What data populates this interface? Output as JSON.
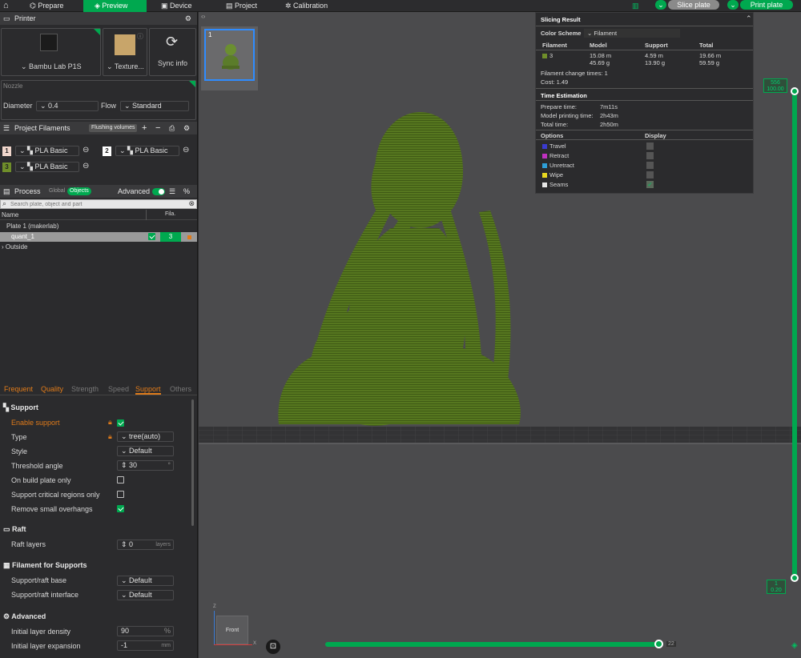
{
  "topbar": {
    "tabs": [
      "Prepare",
      "Preview",
      "Device",
      "Project",
      "Calibration"
    ],
    "slice_label": "Slice plate",
    "print_label": "Print plate"
  },
  "printer": {
    "section_title": "Printer",
    "model": "Bambu Lab P1S",
    "plate": "Texture...",
    "sync_label": "Sync info",
    "nozzle_label": "Nozzle",
    "diameter_label": "Diameter",
    "diameter_value": "0.4",
    "flow_label": "Flow",
    "flow_value": "Standard"
  },
  "filaments": {
    "section_title": "Project Filaments",
    "flushing_label": "Flushing volumes",
    "items": [
      {
        "num": "1",
        "name": "PLA Basic",
        "color": "#f0d6cc"
      },
      {
        "num": "2",
        "name": "PLA Basic",
        "color": "#ffffff"
      },
      {
        "num": "3",
        "name": "PLA Basic",
        "color": "#6f8e2a"
      }
    ]
  },
  "process": {
    "section_title": "Process",
    "global_label": "Global",
    "objects_label": "Objects",
    "advanced_label": "Advanced",
    "search_placeholder": "Search plate, object and part",
    "col_name": "Name",
    "col_fila": "Fila.",
    "plate_row": "Plate 1 (makerlab)",
    "object_name": "quant_1",
    "object_fila": "3",
    "outside_row": "Outside"
  },
  "settings_tabs": [
    "Frequent",
    "Quality",
    "Strength",
    "Speed",
    "Support",
    "Others"
  ],
  "support": {
    "title": "Support",
    "enable_label": "Enable support",
    "type_label": "Type",
    "type_value": "tree(auto)",
    "style_label": "Style",
    "style_value": "Default",
    "threshold_label": "Threshold angle",
    "threshold_value": "30",
    "threshold_unit": "°",
    "build_plate_label": "On build plate only",
    "critical_label": "Support critical regions only",
    "remove_label": "Remove small overhangs"
  },
  "raft": {
    "title": "Raft",
    "layers_label": "Raft layers",
    "layers_value": "0",
    "layers_unit": "layers"
  },
  "filament_supports": {
    "title": "Filament for Supports",
    "base_label": "Support/raft base",
    "base_value": "Default",
    "interface_label": "Support/raft interface",
    "interface_value": "Default"
  },
  "advanced": {
    "title": "Advanced",
    "density_label": "Initial layer density",
    "density_value": "90",
    "density_unit": "%",
    "expansion_label": "Initial layer expansion",
    "expansion_value": "-1",
    "expansion_unit": "mm"
  },
  "plate_thumb_label": "1",
  "slicing": {
    "title": "Slicing Result",
    "color_scheme_label": "Color Scheme",
    "color_scheme_value": "Filament",
    "headers": [
      "Filament",
      "Model",
      "Support",
      "Total"
    ],
    "row": {
      "filament": "3",
      "model_len": "15.08 m",
      "model_wt": "45.69 g",
      "support_len": "4.59 m",
      "support_wt": "13.90 g",
      "total_len": "19.66 m",
      "total_wt": "59.59 g"
    },
    "change_times": "Filament change times:  1",
    "cost": "Cost:  1.49",
    "time_title": "Time Estimation",
    "prepare_label": "Prepare time:",
    "prepare_value": "7m11s",
    "model_time_label": "Model printing time:",
    "model_time_value": "2h43m",
    "total_label": "Total time:",
    "total_value": "2h50m",
    "options_label": "Options",
    "display_label": "Display",
    "options": [
      {
        "name": "Travel",
        "color": "#3a3acf",
        "checked": false
      },
      {
        "name": "Retract",
        "color": "#c031c0",
        "checked": false
      },
      {
        "name": "Unretract",
        "color": "#2e9fd8",
        "checked": false
      },
      {
        "name": "Wipe",
        "color": "#e8d820",
        "checked": false
      },
      {
        "name": "Seams",
        "color": "#e6e6e6",
        "checked": true
      }
    ]
  },
  "layer_slider": {
    "top_layer": "556",
    "top_height": "100.00",
    "bottom_layer": "1",
    "bottom_height": "0.20"
  },
  "move_slider_value": "22",
  "view_label": "Front",
  "axes": {
    "z": "Z",
    "x": "X"
  }
}
